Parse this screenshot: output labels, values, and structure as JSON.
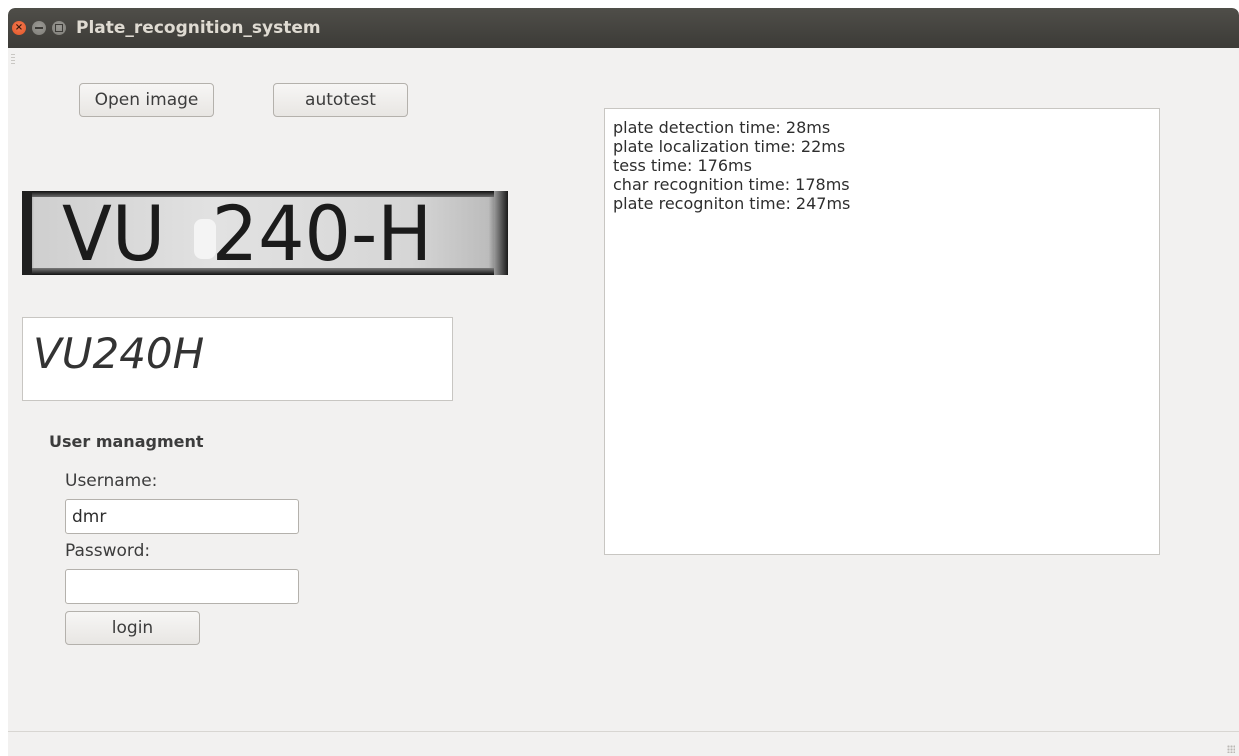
{
  "window": {
    "title": "Plate_recognition_system",
    "close_glyph": "×"
  },
  "toolbar": {
    "open_image_label": "Open image",
    "autotest_label": "autotest"
  },
  "plate_image": {
    "text": "VU  240-H"
  },
  "result": {
    "plate_number": "VU240H"
  },
  "user_management": {
    "title": "User managment",
    "username_label": "Username:",
    "username_value": "dmr",
    "password_label": "Password:",
    "password_value": "",
    "login_label": "login"
  },
  "log": {
    "lines": [
      "plate detection time: 28ms",
      "plate localization time: 22ms",
      "tess time: 176ms",
      "char recognition time: 178ms",
      "plate recogniton time: 247ms"
    ]
  },
  "colors": {
    "titlebar": "#3c3b37",
    "close_button": "#e05526",
    "window_background": "#f2f1f0"
  }
}
